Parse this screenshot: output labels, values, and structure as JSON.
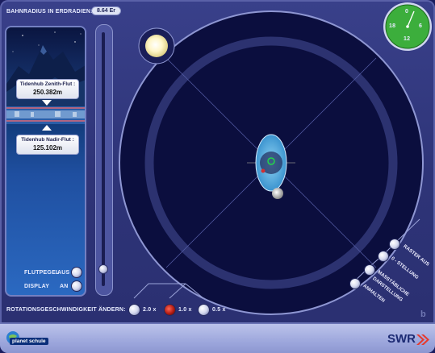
{
  "header": {
    "orbit_radius_label": "BAHNRADIUS IN ERDRADIEN:",
    "orbit_radius_value": "8.64 Er"
  },
  "tide_panel": {
    "zenith_title": "Tidenhub Zenith-Flut :",
    "zenith_value": "250.382m",
    "nadir_title": "Tidenhub Nadir-Flut :",
    "nadir_value": "125.102m"
  },
  "toggles": {
    "flutpegel_label": "FLUTPEGEL",
    "flutpegel_state": "AUS",
    "display_label": "DISPLAY",
    "display_state": "AN"
  },
  "speed": {
    "label": "ROTATIONSGESCHWINDIGKEIT ÄNDERN:",
    "options": [
      {
        "label": "2.0 x",
        "active": false
      },
      {
        "label": "1.0 x",
        "active": true
      },
      {
        "label": "0.5 x",
        "active": false
      }
    ]
  },
  "clock": {
    "n0": "0",
    "n6": "6",
    "n12": "12",
    "n18": "18",
    "color": "#3cae3c"
  },
  "right_menu": {
    "raster": "RASTER AUS",
    "stellung": "0 - STELLUNG",
    "mass1": "MASSTÄBLICHE",
    "mass2": "DARSTELLUNG",
    "anhalten": "ANHALTEN"
  },
  "footer": {
    "logo_text": "planet schule",
    "brand": "SWR",
    "brand_color": "#e63a2e"
  },
  "corner_mark": "b"
}
